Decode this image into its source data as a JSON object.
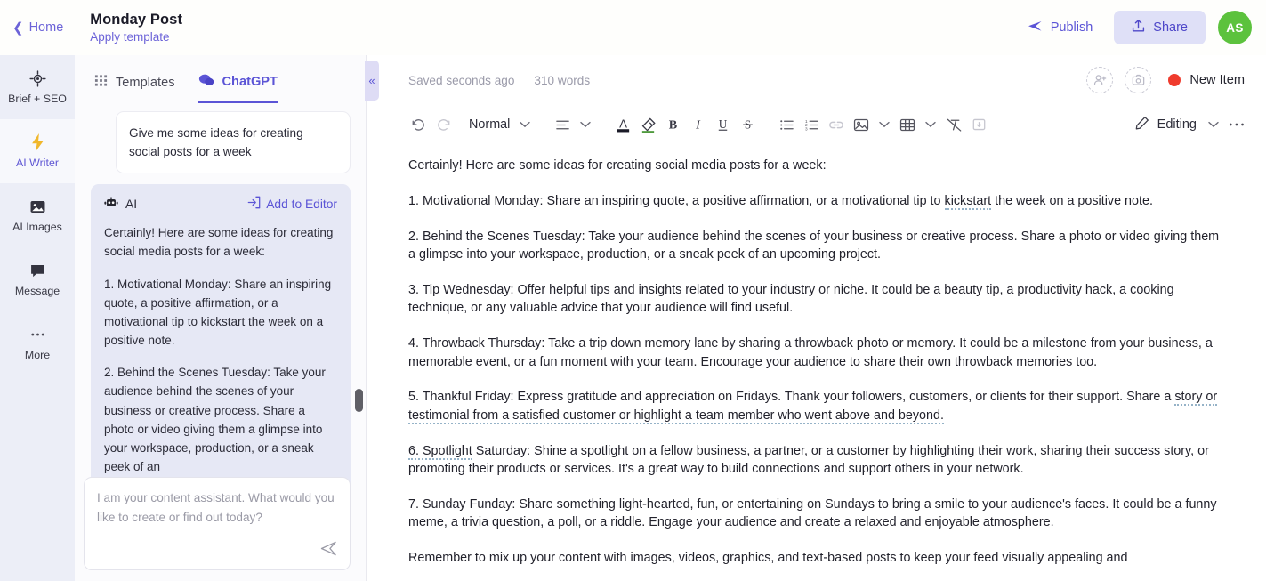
{
  "header": {
    "home_label": "Home",
    "title": "Monday Post",
    "subtitle": "Apply template",
    "publish_label": "Publish",
    "share_label": "Share",
    "avatar_initials": "AS",
    "accent_color": "#5b54d6",
    "avatar_color": "#5cc23d"
  },
  "rail": {
    "items": [
      {
        "label": "Brief + SEO",
        "icon": "target-icon",
        "active": false
      },
      {
        "label": "AI Writer",
        "icon": "lightning-icon",
        "active": true
      },
      {
        "label": "AI Images",
        "icon": "image-icon",
        "active": false
      },
      {
        "label": "Message",
        "icon": "chat-bubble-icon",
        "active": false
      },
      {
        "label": "More",
        "icon": "ellipsis-icon",
        "active": false
      }
    ]
  },
  "chat": {
    "tabs": [
      {
        "label": "Templates",
        "icon": "grid-icon",
        "active": false
      },
      {
        "label": "ChatGPT",
        "icon": "chat-icon",
        "active": true
      }
    ],
    "user_message": "Give me some ideas for creating social posts for a week",
    "ai_label": "AI",
    "add_to_editor_label": "Add to Editor",
    "ai_paragraphs": [
      "Certainly! Here are some ideas for creating social media posts for a week:",
      "1. Motivational Monday: Share an inspiring quote, a positive affirmation, or a motivational tip to kickstart the week on a positive note.",
      "2. Behind the Scenes Tuesday: Take your audience behind the scenes of your business or creative process. Share a photo or video giving them a glimpse into your workspace, production, or a sneak peek of an"
    ],
    "composer_placeholder": "I am your content assistant. What would you like to create or find out today?",
    "collapse_label": "«"
  },
  "editor": {
    "saved_status": "Saved seconds ago",
    "word_count": "310 words",
    "new_item_label": "New Item",
    "new_item_dot_color": "#ef3b2d",
    "toolbar": {
      "style_label": "Normal",
      "editing_label": "Editing",
      "undo": "undo-icon",
      "redo": "redo-icon"
    },
    "document": {
      "paragraphs": [
        {
          "text": "Certainly! Here are some ideas for creating social media posts for a week:"
        },
        {
          "pre": "1. Motivational Monday: Share an inspiring quote, a positive affirmation, or a motivational tip to ",
          "spell": "kickstart",
          "post": " the week on a positive note."
        },
        {
          "text": "2. Behind the Scenes Tuesday: Take your audience behind the scenes of your business or creative process. Share a photo or video giving them a glimpse into your workspace, production, or a sneak peek of an upcoming project."
        },
        {
          "text": "3. Tip Wednesday: Offer helpful tips and insights related to your industry or niche. It could be a beauty tip, a productivity hack, a cooking technique, or any valuable advice that your audience will find useful."
        },
        {
          "text": "4. Throwback Thursday: Take a trip down memory lane by sharing a throwback photo or memory. It could be a milestone from your business, a memorable event, or a fun moment with your team. Encourage your audience to share their own throwback memories too."
        },
        {
          "pre": "5. Thankful Friday: Express gratitude and appreciation on Fridays. Thank your followers, customers, or clients for their support. Share a ",
          "spell": "story or testimonial from a satisfied customer or highlight a team member who went above and beyond.",
          "post": ""
        },
        {
          "pre": "",
          "spell": "6. Spotlight",
          "post": " Saturday: Shine a spotlight on a fellow business, a partner, or a customer by highlighting their work, sharing their success story, or promoting their products or services. It's a great way to build connections and support others in your network."
        },
        {
          "text": "7. Sunday Funday: Share something light-hearted, fun, or entertaining on Sundays to bring a smile to your audience's faces. It could be a funny meme, a trivia question, a poll, or a riddle. Engage your audience and create a relaxed and enjoyable atmosphere."
        },
        {
          "text": "Remember to mix up your content with images, videos, graphics, and text-based posts to keep your feed visually appealing and"
        }
      ]
    }
  }
}
